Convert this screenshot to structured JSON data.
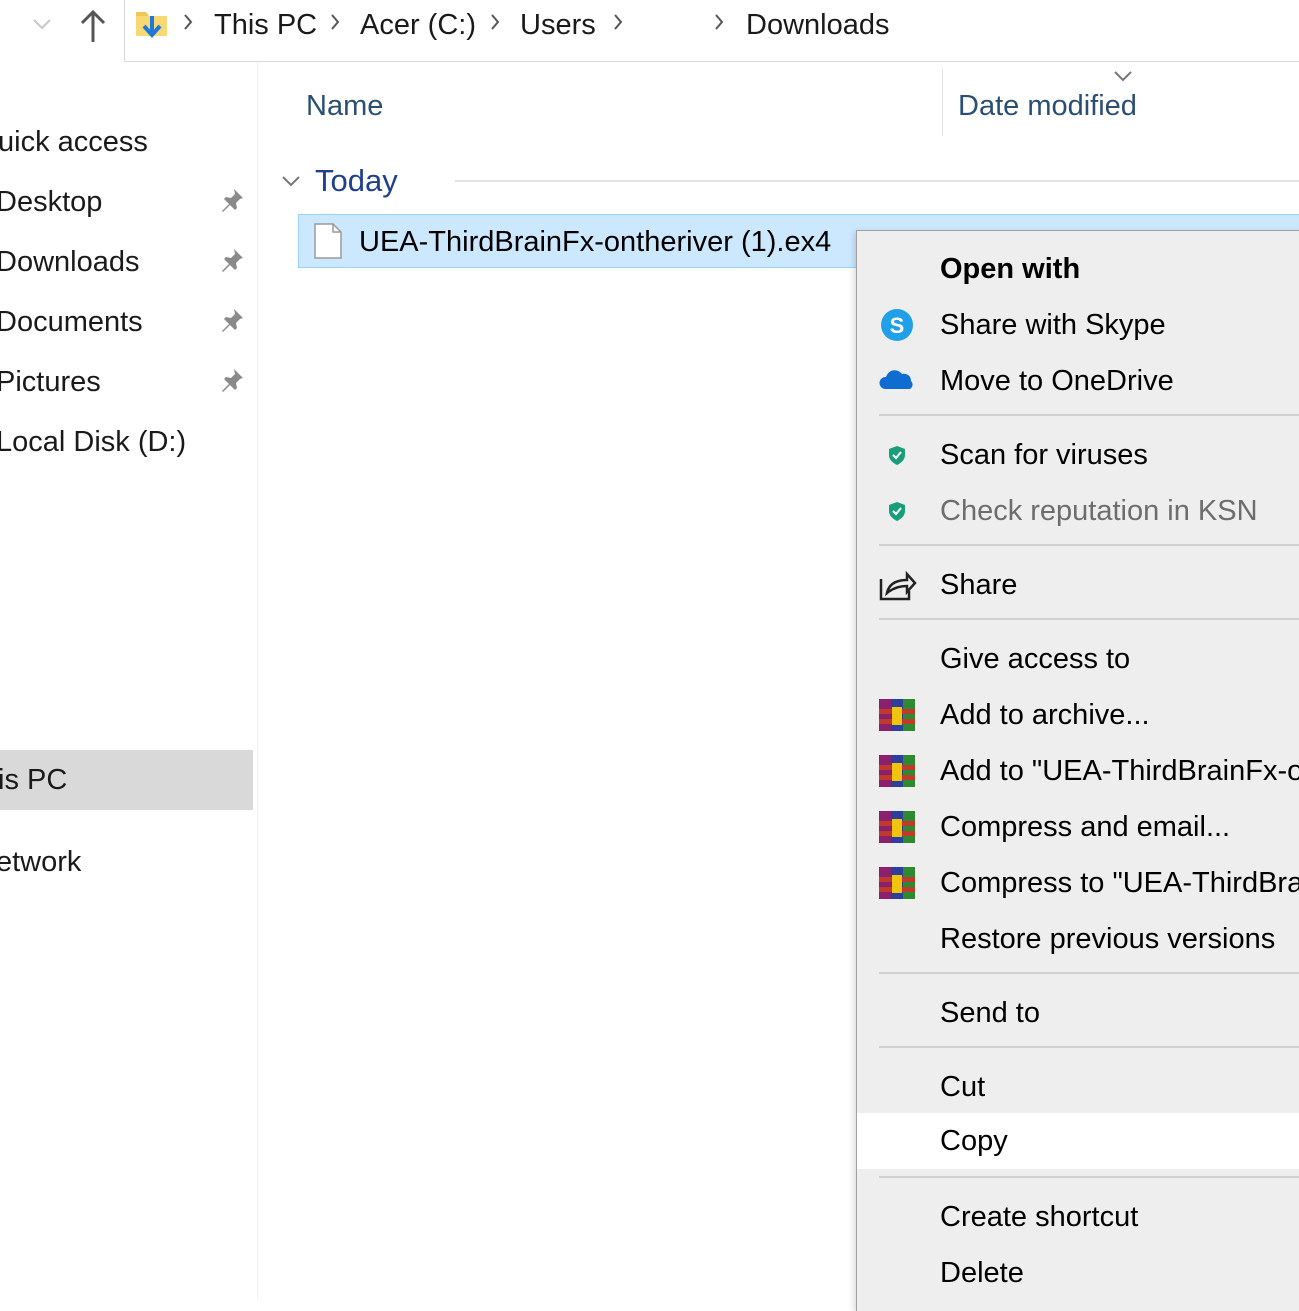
{
  "breadcrumb": {
    "items": [
      "This PC",
      "Acer (C:)",
      "Users",
      "",
      "Downloads"
    ]
  },
  "sidebar": {
    "items": [
      {
        "label": "uick access",
        "pinned": false
      },
      {
        "label": "Desktop",
        "pinned": true
      },
      {
        "label": "Downloads",
        "pinned": true
      },
      {
        "label": "Documents",
        "pinned": true
      },
      {
        "label": "Pictures",
        "pinned": true
      },
      {
        "label": "Local Disk (D:)",
        "pinned": false
      },
      {
        "label": "is PC",
        "pinned": false,
        "selected": true
      },
      {
        "label": "etwork",
        "pinned": false
      }
    ]
  },
  "columns": {
    "name": "Name",
    "date_modified": "Date modified"
  },
  "group": {
    "label": "Today"
  },
  "file": {
    "name": "UEA-ThirdBrainFx-ontheriver (1).ex4"
  },
  "context_menu": {
    "items": [
      {
        "label": "Open with",
        "bold": true
      },
      {
        "label": "Share with Skype",
        "icon": "skype-icon"
      },
      {
        "label": "Move to OneDrive",
        "icon": "onedrive-icon"
      },
      {
        "label": "Scan for viruses",
        "icon": "kaspersky-shield-icon"
      },
      {
        "label": "Check reputation in KSN",
        "icon": "kaspersky-shield-icon",
        "disabled": true
      },
      {
        "label": "Share",
        "icon": "share-icon"
      },
      {
        "label": "Give access to"
      },
      {
        "label": "Add to archive...",
        "icon": "winrar-icon"
      },
      {
        "label": "Add to \"UEA-ThirdBrainFx-o",
        "icon": "winrar-icon"
      },
      {
        "label": "Compress and email...",
        "icon": "winrar-icon"
      },
      {
        "label": "Compress to \"UEA-ThirdBra",
        "icon": "winrar-icon"
      },
      {
        "label": "Restore previous versions"
      },
      {
        "label": "Send to"
      },
      {
        "label": "Cut"
      },
      {
        "label": "Copy",
        "hovered": true
      },
      {
        "label": "Create shortcut"
      },
      {
        "label": "Delete"
      }
    ]
  },
  "colors": {
    "selection": "#cce8ff",
    "header_text": "#2b4e73",
    "group_text": "#1f3f8f",
    "menu_bg": "#eeeeee"
  }
}
